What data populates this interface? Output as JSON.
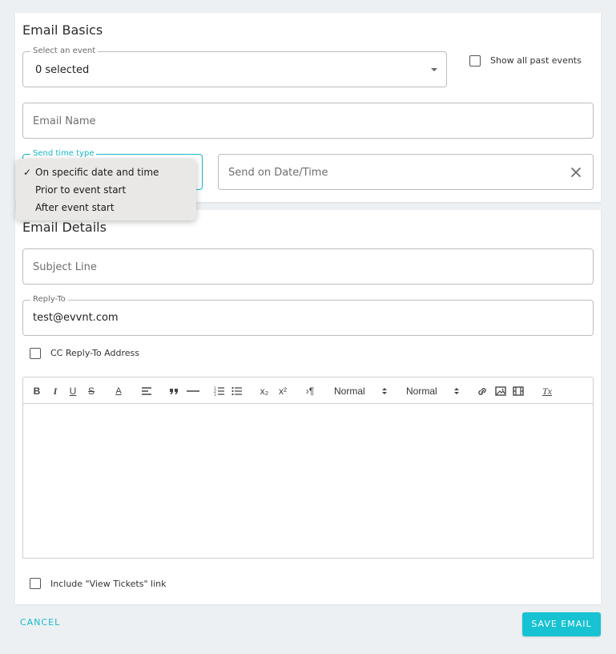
{
  "basics": {
    "title": "Email Basics",
    "event_select": {
      "legend": "Select an event",
      "value": "0 selected"
    },
    "show_past": {
      "label": "Show all past events",
      "checked": false
    },
    "email_name": {
      "placeholder": "Email Name"
    },
    "send_time_type": {
      "legend": "Send time type"
    },
    "send_date": {
      "placeholder": "Send on Date/Time"
    }
  },
  "send_time_menu": {
    "items": [
      {
        "label": "On specific date and time",
        "selected": true
      },
      {
        "label": "Prior to event start",
        "selected": false
      },
      {
        "label": "After event start",
        "selected": false
      }
    ],
    "check_glyph": "✓"
  },
  "details": {
    "title": "Email Details",
    "subject": {
      "placeholder": "Subject Line"
    },
    "reply_to": {
      "legend": "Reply-To",
      "value": "test@evvnt.com"
    },
    "cc_reply": {
      "label": "CC Reply-To Address",
      "checked": false
    },
    "toolbar": {
      "font_size": "Normal",
      "header": "Normal",
      "bold": "B",
      "italic": "I",
      "underline": "U",
      "strike": "S",
      "color": "A",
      "subscript": "x₂",
      "superscript": "x²",
      "rtl": "›¶",
      "clean": "Tx"
    },
    "view_tickets": {
      "label": "Include \"View Tickets\" link",
      "checked": false
    }
  },
  "footer": {
    "cancel_label": "CANCEL",
    "save_label": "SAVE EMAIL"
  },
  "colors": {
    "accent": "#17c2d2"
  }
}
